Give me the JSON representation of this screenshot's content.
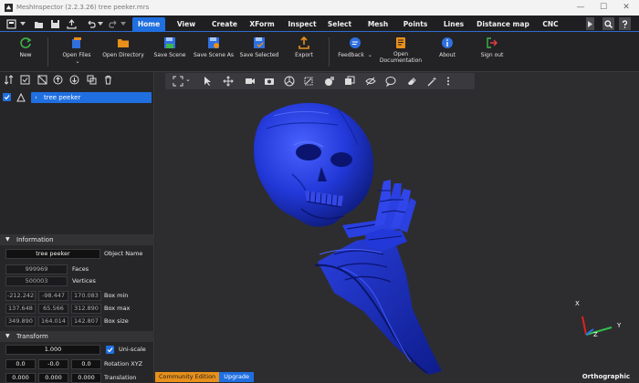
{
  "window": {
    "title": "MeshInspector (2.2.3.26) tree peeker.mrs",
    "minimize": "—",
    "maximize": "☐",
    "close": "✕"
  },
  "tabs": [
    {
      "label": "Home",
      "active": true
    },
    {
      "label": "View"
    },
    {
      "label": "Create"
    },
    {
      "label": "XForm"
    },
    {
      "label": "Inspect"
    },
    {
      "label": "Select"
    },
    {
      "label": "Mesh"
    },
    {
      "label": "Points"
    },
    {
      "label": "Lines"
    },
    {
      "label": "Distance map"
    },
    {
      "label": "CNC"
    }
  ],
  "ribbon": {
    "new": "New",
    "open_files": "Open Files",
    "open_directory": "Open Directory",
    "save_scene": "Save Scene",
    "save_scene_as": "Save Scene As",
    "save_selected": "Save Selected",
    "export": "Export",
    "feedback": "Feedback",
    "open_documentation_1": "Open",
    "open_documentation_2": "Documentation",
    "about": "About",
    "sign_out": "Sign out"
  },
  "scene_tree": {
    "item_label": "tree peeker",
    "checked": true
  },
  "information": {
    "header": "Information",
    "object_name_value": "tree peeker",
    "object_name_label": "Object Name",
    "faces_value": "999969",
    "faces_label": "Faces",
    "vertices_value": "500003",
    "vertices_label": "Vertices",
    "box_min": [
      "-212.242",
      "-98.447",
      "170.083"
    ],
    "box_min_label": "Box min",
    "box_max": [
      "137.648",
      "65.566",
      "312.890"
    ],
    "box_max_label": "Box max",
    "box_size": [
      "349.890",
      "164.014",
      "142.807"
    ],
    "box_size_label": "Box size"
  },
  "transform": {
    "header": "Transform",
    "scale_value": "1.000",
    "uniscale_label": "Uni-scale",
    "rotation": [
      "0.0",
      "-0.0",
      "0.0"
    ],
    "rotation_label": "Rotation XYZ",
    "translation": [
      "0.000",
      "0.000",
      "0.000"
    ],
    "translation_label": "Translation"
  },
  "viewport": {
    "edition_label": "Community Edition",
    "upgrade_label": "Upgrade",
    "projection_label": "Orthographic",
    "axis_x": "X",
    "axis_y": "Y",
    "axis_z": "Z",
    "mesh_color": "#2238d8"
  },
  "colors": {
    "accent": "#1f6fe0",
    "edition": "#e8901a"
  }
}
